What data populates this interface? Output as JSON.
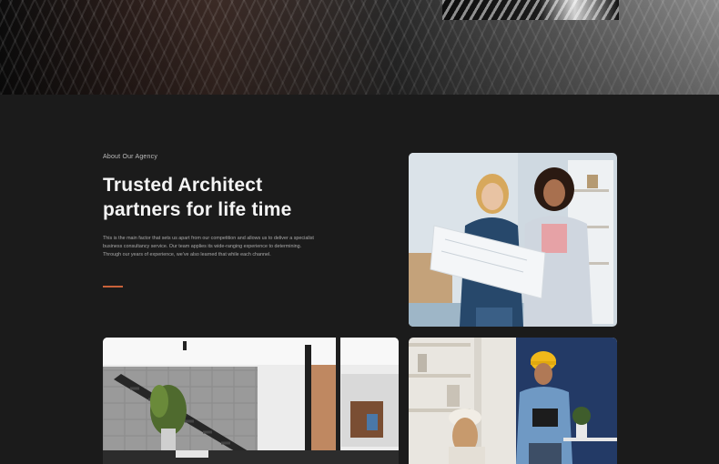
{
  "about": {
    "eyebrow": "About Our Agency",
    "title_line1": "Trusted Architect",
    "title_line2": "partners for life time",
    "body": "This is the main factor that sets us apart from our competition and allows us to deliver a specialist business consultancy service. Our team applies its wide-ranging experience to determining. Through our years of experience, we've also learned that while each channel.",
    "accent_color": "#c9623a"
  },
  "images": {
    "hero": "abstract-architecture-facade",
    "women": "two-women-reviewing-blueprint",
    "interior": "modern-interior-staircase",
    "workers": "workers-with-hard-hat-and-tablet"
  }
}
